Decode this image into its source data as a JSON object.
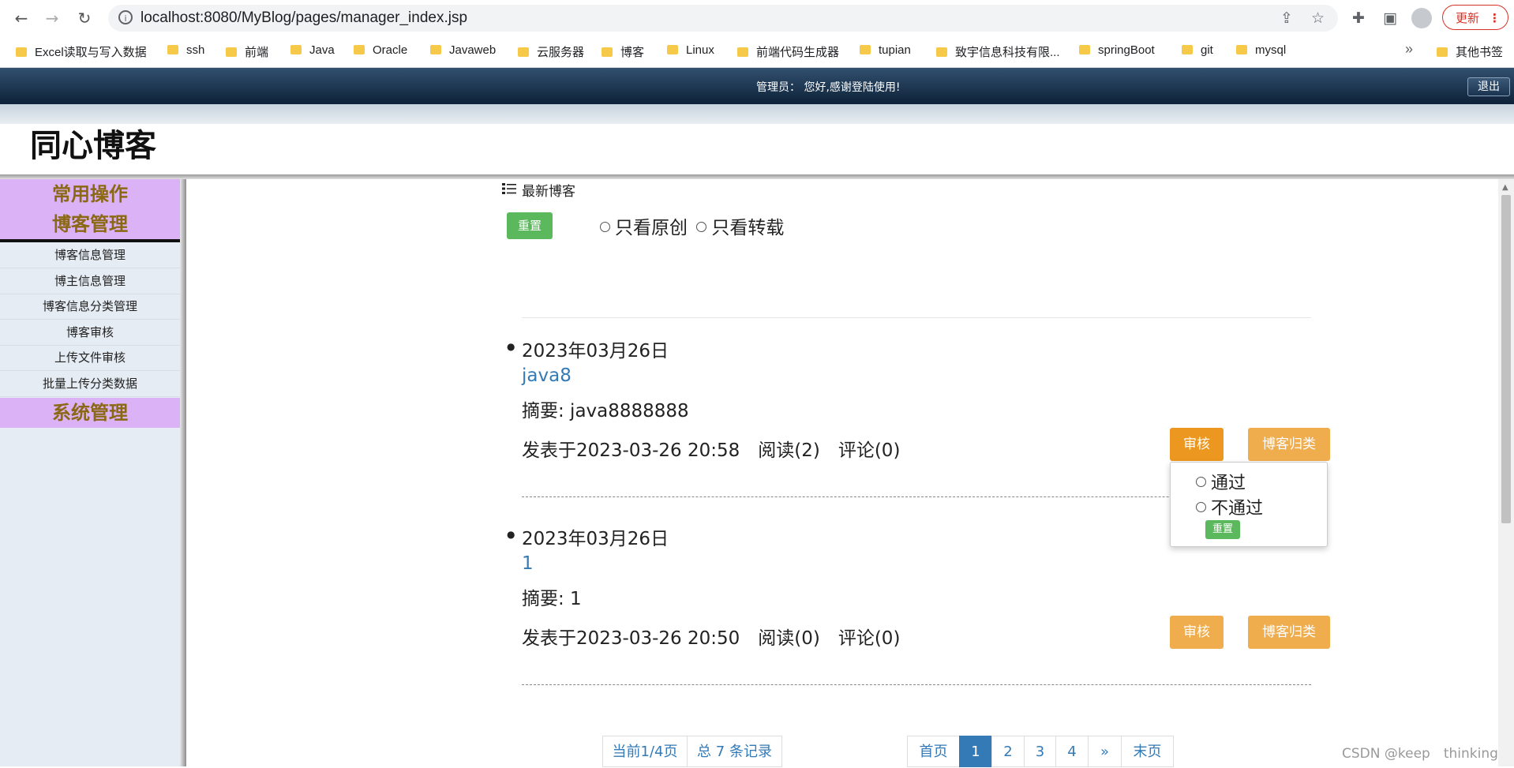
{
  "browser": {
    "url": "localhost:8080/MyBlog/pages/manager_index.jsp",
    "update_label": "更新",
    "bookmarks": [
      "Excel读取与写入数据",
      "ssh",
      "前端",
      "Java",
      "Oracle",
      "Javaweb",
      "云服务器",
      "博客",
      "Linux",
      "前端代码生成器",
      "tupian",
      "致宇信息科技有限...",
      "springBoot",
      "git",
      "mysql"
    ],
    "more_bookmarks": "»",
    "other_bookmarks": "其他书签"
  },
  "header": {
    "welcome": "管理员： 您好,感谢登陆使用!",
    "logout": "退出",
    "site_title": "同心博客"
  },
  "sidebar": {
    "group1_line1": "常用操作",
    "group1_line2": "博客管理",
    "items": [
      "博客信息管理",
      "博主信息管理",
      "博客信息分类管理",
      "博客审核",
      "上传文件审核",
      "批量上传分类数据"
    ],
    "group2": "系统管理"
  },
  "content": {
    "list_title": "最新博客",
    "reset": "重置",
    "filter_original": "只看原创",
    "filter_repost": "只看转载",
    "posts": [
      {
        "date": "2023年03月26日",
        "title": "java8",
        "abstract": "摘要: java8888888",
        "meta": "发表于2023-03-26 20:58　阅读(2)　评论(0)",
        "audit": "审核",
        "category": "博客归类"
      },
      {
        "date": "2023年03月26日",
        "title": "1",
        "abstract": "摘要: 1",
        "meta": "发表于2023-03-26 20:50　阅读(0)　评论(0)",
        "audit": "审核",
        "category": "博客归类"
      }
    ],
    "audit_popup": {
      "pass": "通过",
      "reject": "不通过",
      "reset": "重置"
    }
  },
  "pagination": {
    "current": "当前1/4页",
    "total": "总 7 条记录",
    "first": "首页",
    "pages": [
      "1",
      "2",
      "3",
      "4"
    ],
    "next": "»",
    "last": "末页"
  },
  "watermark": "CSDN @keep　thinking",
  "colors": {
    "accent": "#337ab7",
    "warning": "#f0ad4e",
    "warning_active": "#ec971f",
    "success": "#5cb85c",
    "sidebar_head": "#dcb2f7"
  }
}
